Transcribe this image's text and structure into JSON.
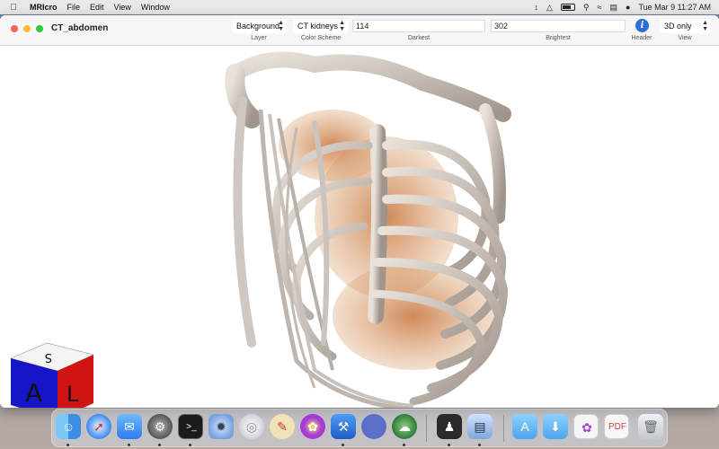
{
  "menubar": {
    "app_name": "MRIcro",
    "menus": [
      "File",
      "Edit",
      "View",
      "Window"
    ],
    "clock": "Tue Mar 9  11:27 AM",
    "status_icons": [
      "arrows-updown-icon",
      "bluetooth-icon",
      "battery-icon",
      "search-icon",
      "wifi-icon",
      "control-center-icon",
      "siri-icon"
    ]
  },
  "window": {
    "title": "CT_abdomen"
  },
  "toolbar": {
    "layer": {
      "value": "Background",
      "label": "Layer"
    },
    "color_scheme": {
      "value": "CT kidneys",
      "label": "Color Scheme"
    },
    "darkest": {
      "value": "114",
      "label": "Darkest"
    },
    "brightest": {
      "value": "302",
      "label": "Brightest"
    },
    "header": {
      "label": "Header",
      "icon": "info-icon"
    },
    "view": {
      "value": "3D only",
      "label": "View"
    }
  },
  "orientation_cube": {
    "front": "A",
    "side": "L",
    "top": "S"
  },
  "accent_colors": {
    "info_blue": "#2b6fd6",
    "close": "#fe5f57",
    "minimize": "#febc2e",
    "maximize": "#28c840"
  },
  "dock": {
    "apps": [
      "finder-icon",
      "safari-icon",
      "mail-icon",
      "system-preferences-icon",
      "terminal-icon",
      "settings-gear-icon",
      "disk-utility-icon",
      "paint-palette-icon",
      "flower-icon",
      "xcode-icon",
      "oval-app-icon",
      "brain-icon",
      "silhouette-app-icon",
      "preview-app-icon",
      "applications-folder-icon",
      "downloads-folder-icon",
      "document-stack-icon",
      "pdf-stack-icon",
      "trash-icon"
    ]
  }
}
